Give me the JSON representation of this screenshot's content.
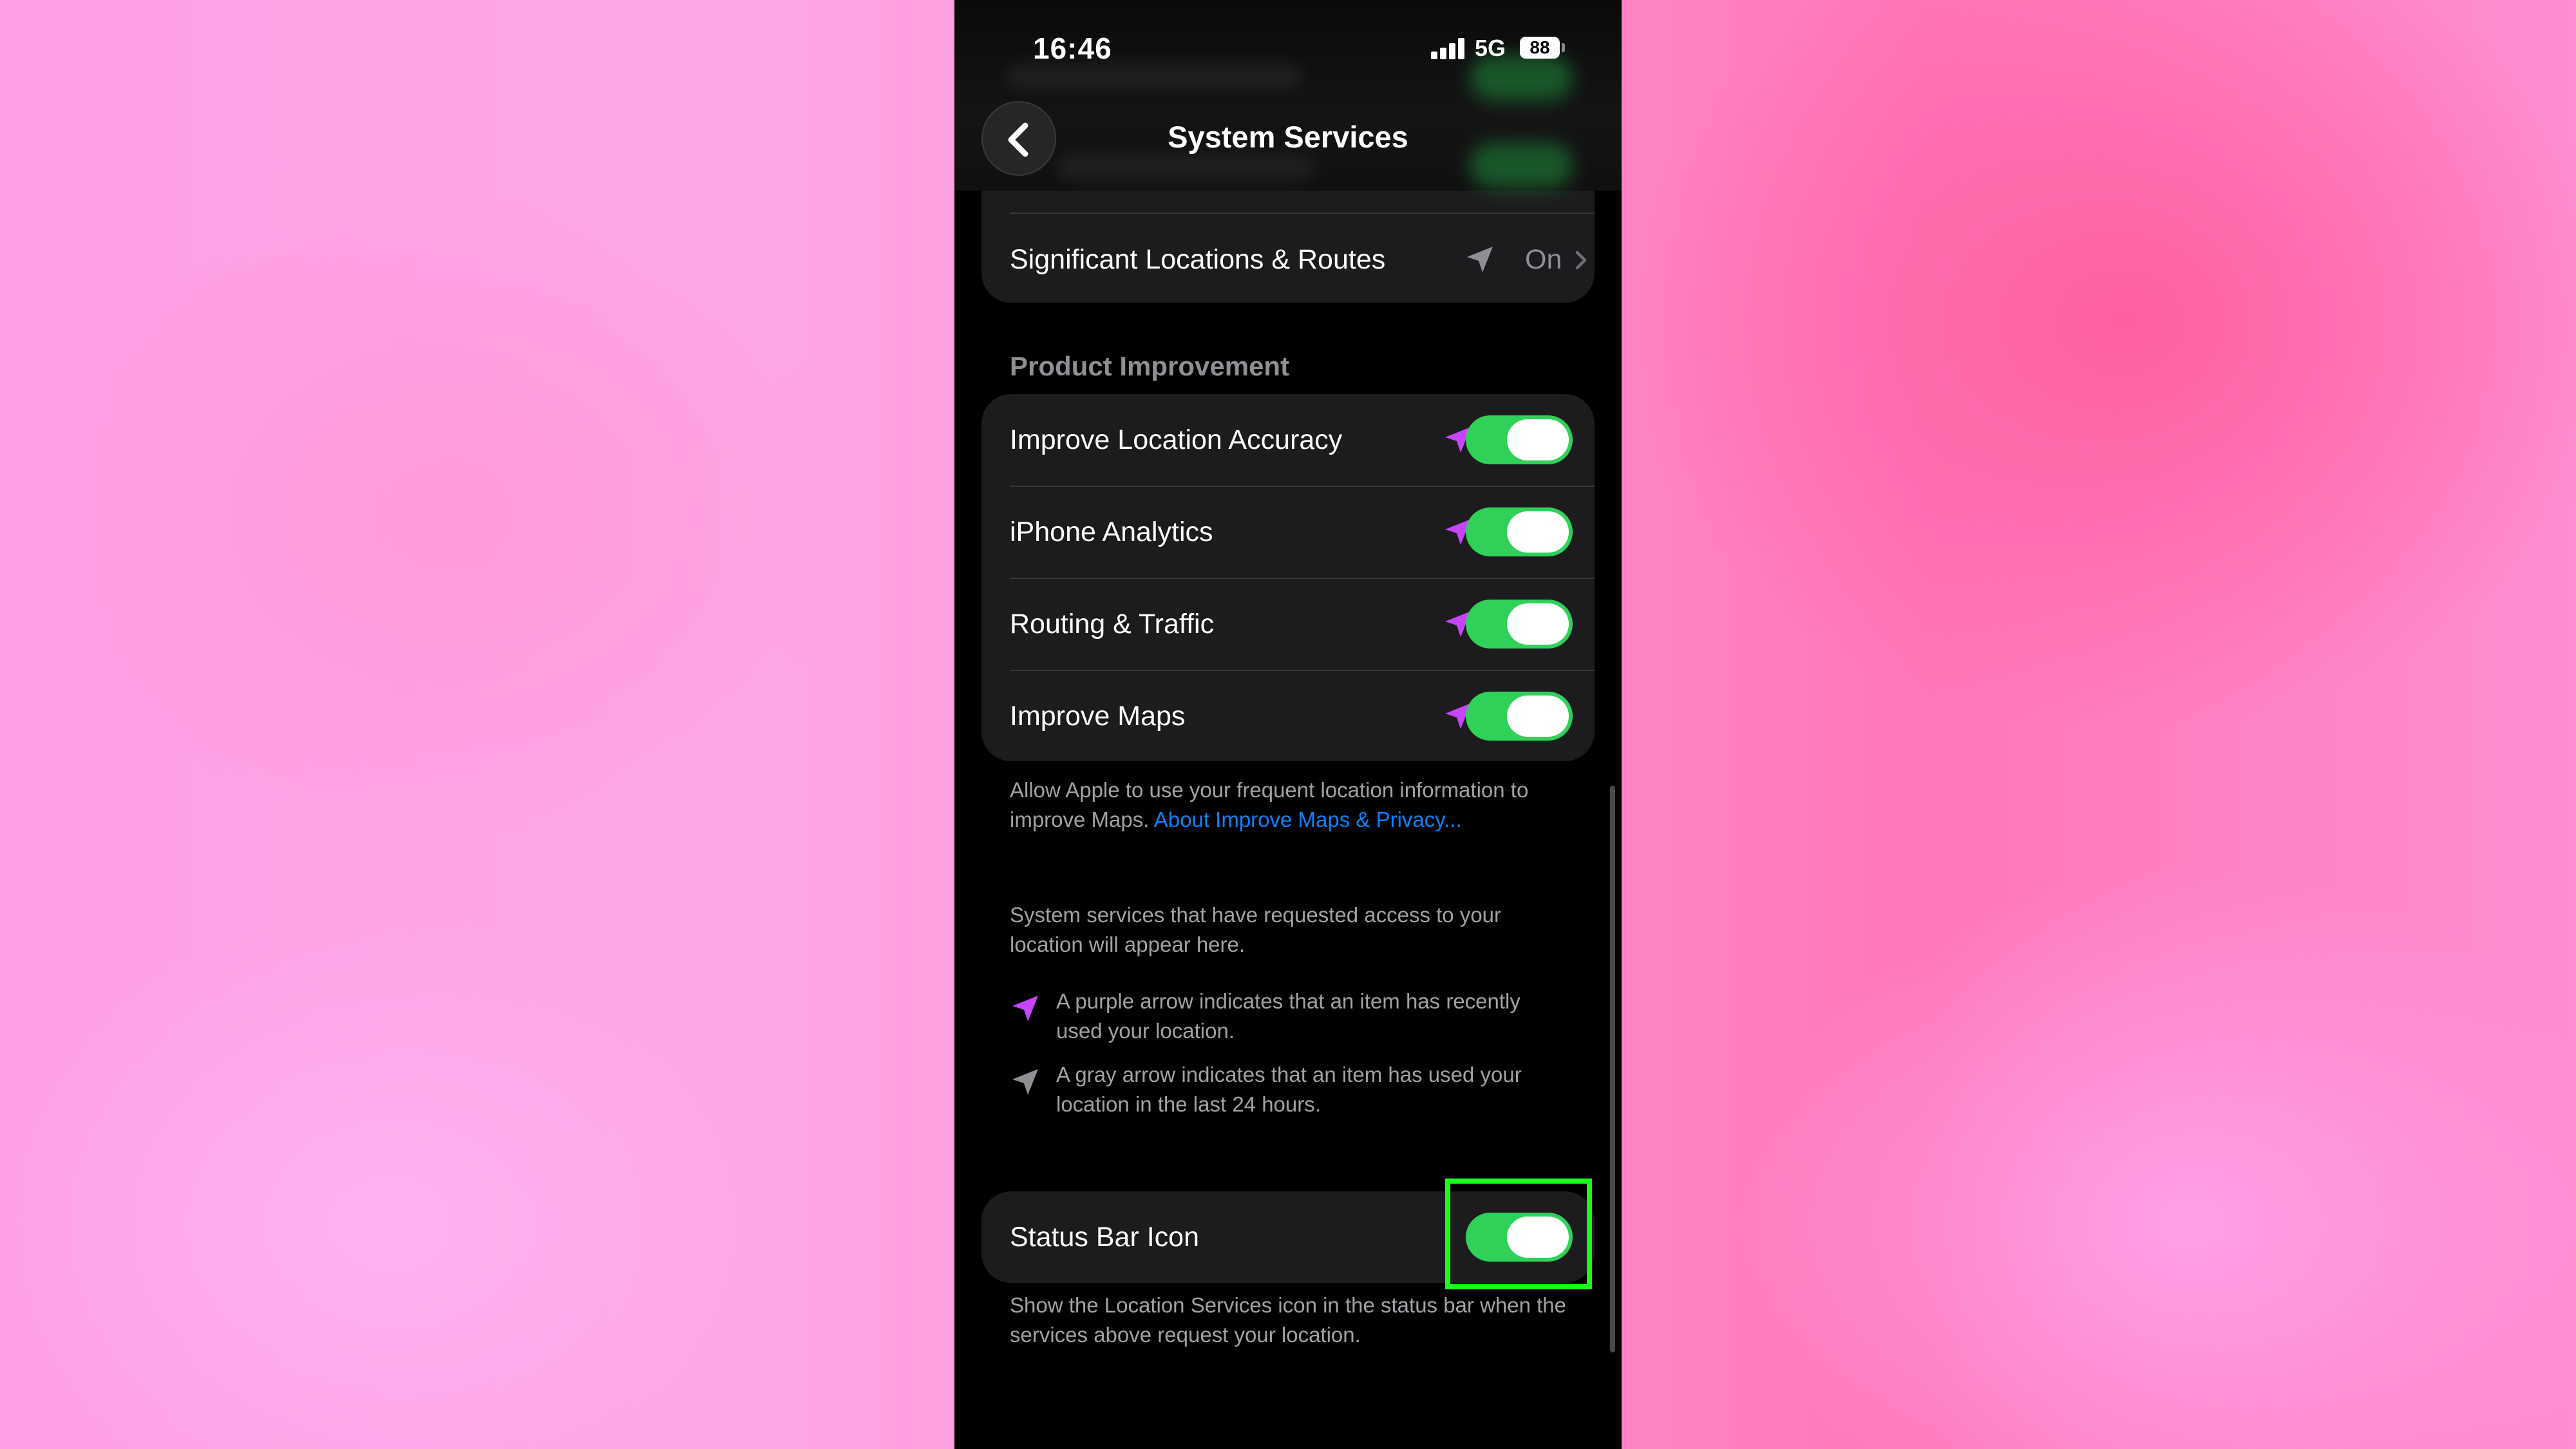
{
  "status_bar": {
    "time": "16:46",
    "network": "5G",
    "battery": "88"
  },
  "nav": {
    "title": "System Services"
  },
  "locations": {
    "label": "Significant Locations & Routes",
    "value": "On"
  },
  "product_improvement": {
    "header": "Product Improvement",
    "items": [
      {
        "label": "Improve Location Accuracy",
        "on": true
      },
      {
        "label": "iPhone Analytics",
        "on": true
      },
      {
        "label": "Routing & Traffic",
        "on": true
      },
      {
        "label": "Improve Maps",
        "on": true
      }
    ],
    "footer_text": "Allow Apple to use your frequent location information to improve Maps.",
    "footer_link": "About Improve Maps & Privacy..."
  },
  "info": {
    "text": "System services that have requested access to your location will appear here.",
    "purple_legend": "A purple arrow indicates that an item has recently used your location.",
    "gray_legend": "A gray arrow indicates that an item has used your location in the last 24 hours."
  },
  "status_bar_icon": {
    "label": "Status Bar Icon",
    "on": true,
    "footer": "Show the Location Services icon in the status bar when the services above request your location."
  },
  "colors": {
    "toggle_on": "#30d158",
    "purple_arrow": "#c644fc",
    "gray_arrow": "#8e8e93",
    "link": "#0a84ff",
    "highlight": "#18ff18"
  }
}
